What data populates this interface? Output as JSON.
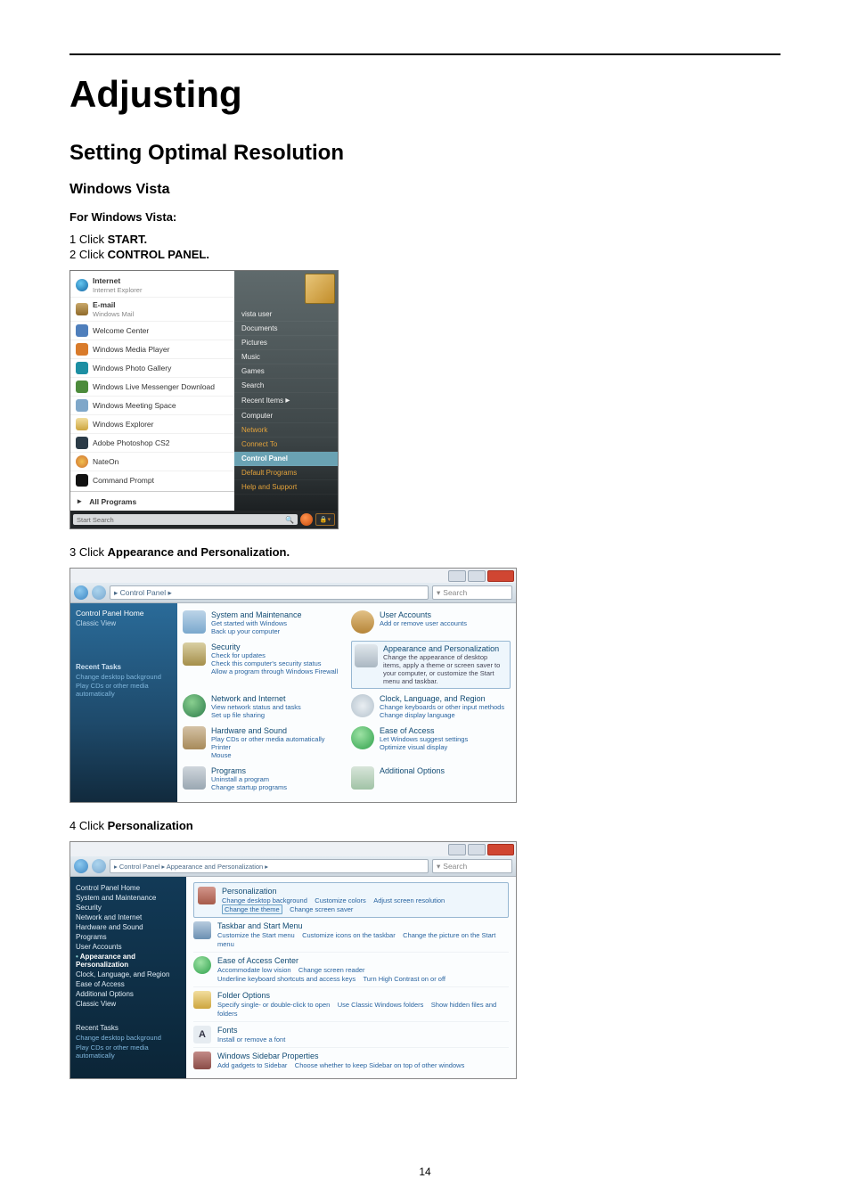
{
  "page_number": "14",
  "headings": {
    "h1": "Adjusting",
    "h2": "Setting Optimal Resolution",
    "h3": "Windows Vista",
    "subhead": "For Windows Vista:"
  },
  "steps": {
    "s1_prefix": "1 Click ",
    "s1_bold": "START.",
    "s2_prefix": "2 Click ",
    "s2_bold": "CONTROL PANEL.",
    "s3_prefix": "3 Click ",
    "s3_bold": "Appearance and Personalization.",
    "s4_prefix": "4 Click ",
    "s4_bold": "Personalization"
  },
  "shot1": {
    "left": {
      "internet": "Internet",
      "internet_sub": "Internet Explorer",
      "email": "E-mail",
      "email_sub": "Windows Mail",
      "welcome": "Welcome Center",
      "media_player": "Windows Media Player",
      "photo_gallery": "Windows Photo Gallery",
      "live_messenger": "Windows Live Messenger Download",
      "meeting_space": "Windows Meeting Space",
      "explorer": "Windows Explorer",
      "photoshop": "Adobe Photoshop CS2",
      "nateon": "NateOn",
      "cmd": "Command Prompt",
      "all_programs": "All Programs",
      "search_label": "Start Search"
    },
    "right": {
      "user": "vista user",
      "documents": "Documents",
      "pictures": "Pictures",
      "music": "Music",
      "games": "Games",
      "search": "Search",
      "recent": "Recent Items",
      "computer": "Computer",
      "network": "Network",
      "connect": "Connect To",
      "control_panel": "Control Panel",
      "default_programs": "Default Programs",
      "help": "Help and Support",
      "arrow": "▸"
    }
  },
  "shot2": {
    "crumb": "▸ Control Panel ▸",
    "search": "Search",
    "side": {
      "heading": "Control Panel Home",
      "classic": "Classic View",
      "recent_h": "Recent Tasks",
      "recent1": "Change desktop background",
      "recent2": "Play CDs or other media automatically"
    },
    "cats": {
      "system_h": "System and Maintenance",
      "system_l1": "Get started with Windows",
      "system_l2": "Back up your computer",
      "security_h": "Security",
      "security_l1": "Check for updates",
      "security_l2": "Check this computer's security status",
      "security_l3": "Allow a program through Windows Firewall",
      "network_h": "Network and Internet",
      "network_l1": "View network status and tasks",
      "network_l2": "Set up file sharing",
      "hardware_h": "Hardware and Sound",
      "hardware_l1": "Play CDs or other media automatically",
      "hardware_l2": "Printer",
      "hardware_l3": "Mouse",
      "programs_h": "Programs",
      "programs_l1": "Uninstall a program",
      "programs_l2": "Change startup programs",
      "user_h": "User Accounts",
      "user_l1": "Add or remove user accounts",
      "appear_h": "Appearance and Personalization",
      "appear_l1": "Change the appearance of desktop items, apply a theme or screen saver to your computer, or customize the Start menu and taskbar.",
      "clock_h": "Clock, Language, and Region",
      "clock_l1": "Change keyboards or other input methods",
      "clock_l2": "Change display language",
      "ease_h": "Ease of Access",
      "ease_l1": "Let Windows suggest settings",
      "ease_l2": "Optimize visual display",
      "add_h": "Additional Options"
    }
  },
  "shot3": {
    "crumb": "▸ Control Panel ▸ Appearance and Personalization ▸",
    "search": "Search",
    "side": {
      "i0": "Control Panel Home",
      "i1": "System and Maintenance",
      "i2": "Security",
      "i3": "Network and Internet",
      "i4": "Hardware and Sound",
      "i5": "Programs",
      "i6": "User Accounts",
      "i7": "Appearance and Personalization",
      "i8": "Clock, Language, and Region",
      "i9": "Ease of Access",
      "i10": "Additional Options",
      "i11": "Classic View",
      "recent_h": "Recent Tasks",
      "recent1": "Change desktop background",
      "recent2": "Play CDs or other media automatically"
    },
    "rows": {
      "pers_h": "Personalization",
      "pers_l1": "Change desktop background",
      "pers_l2": "Customize colors",
      "pers_l3": "Adjust screen resolution",
      "pers_l4": "Change screen saver",
      "pers_boxed": "Change the theme",
      "task_h": "Taskbar and Start Menu",
      "task_l1": "Customize the Start menu",
      "task_l2": "Customize icons on the taskbar",
      "task_l3": "Change the picture on the Start menu",
      "ease_h": "Ease of Access Center",
      "ease_l1": "Accommodate low vision",
      "ease_l2": "Change screen reader",
      "ease_l3": "Underline keyboard shortcuts and access keys",
      "ease_l4": "Turn High Contrast on or off",
      "fold_h": "Folder Options",
      "fold_l1": "Specify single- or double-click to open",
      "fold_l2": "Use Classic Windows folders",
      "fold_l3": "Show hidden files and folders",
      "font_h": "Fonts",
      "font_l1": "Install or remove a font",
      "side_h": "Windows Sidebar Properties",
      "side_l1": "Add gadgets to Sidebar",
      "side_l2": "Choose whether to keep Sidebar on top of other windows"
    }
  }
}
